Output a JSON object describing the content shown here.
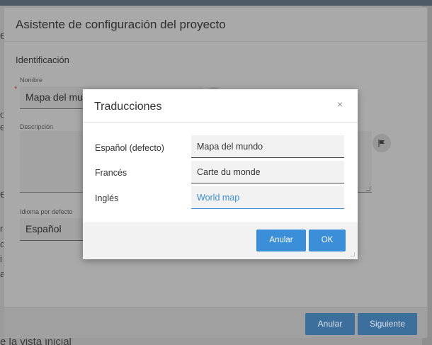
{
  "background": {
    "bottom_text": "e la vista inicial",
    "frag_e1": "e",
    "frag_o": "o",
    "frag_e2": "e",
    "frag_e3": "e",
    "frag_r": "r",
    "frag_c": "c",
    "frag_i": "i",
    "frag_a": "a"
  },
  "wizard": {
    "title": "Asistente de configuración del proyecto",
    "section_title": "Identificación",
    "name_label": "Nombre",
    "name_value": "Mapa del mundo",
    "description_label": "Descripción",
    "language_label": "Idioma por defecto",
    "language_value": "Español",
    "cancel_label": "Anular",
    "next_label": "Siguiente"
  },
  "dialog": {
    "title": "Traducciones",
    "close_symbol": "×",
    "rows": [
      {
        "label": "Español (defecto)",
        "value": "Mapa del mundo"
      },
      {
        "label": "Francés",
        "value": "Carte du monde"
      },
      {
        "label": "Inglés",
        "value": "World map"
      }
    ],
    "cancel_label": "Anular",
    "ok_label": "OK"
  },
  "colors": {
    "accent": "#3b8ed8",
    "required": "#a8322b"
  }
}
